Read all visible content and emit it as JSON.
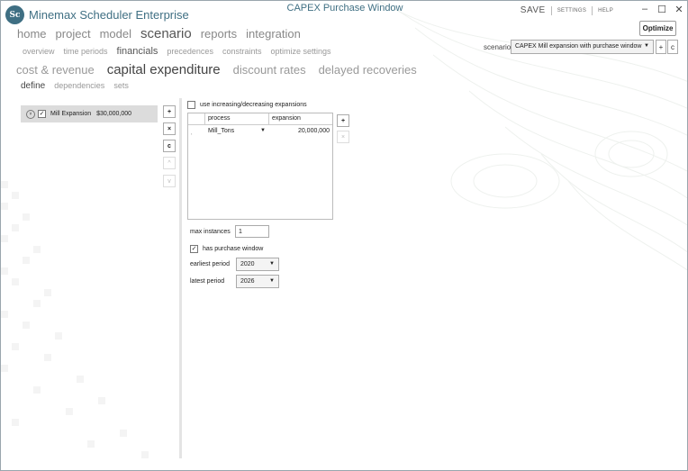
{
  "app": {
    "logo_text": "Sc",
    "name": "Minemax Scheduler Enterprise",
    "window_title": "CAPEX Purchase Window"
  },
  "title_links": {
    "save": "SAVE",
    "settings": "SETTINGS",
    "help": "HELP"
  },
  "window_controls": {
    "minimize": "–",
    "maximize": "☐",
    "close": "✕"
  },
  "optimize_label": "Optimize",
  "nav": {
    "main": [
      "home",
      "project",
      "model",
      "scenario",
      "reports",
      "integration"
    ],
    "main_active": "scenario",
    "scenario_tabs": [
      "overview",
      "time periods",
      "financials",
      "precedences",
      "constraints",
      "optimize settings"
    ],
    "scenario_tabs_active": "financials",
    "financial_tabs": [
      "cost & revenue",
      "capital expenditure",
      "discount rates",
      "delayed recoveries"
    ],
    "financial_tabs_active": "capital expenditure",
    "capex_tabs": [
      "define",
      "dependencies",
      "sets"
    ],
    "capex_tabs_active": "define"
  },
  "scenario": {
    "label": "scenario",
    "selected": "CAPEX Mill expansion with purchase window",
    "add_btn": "+",
    "copy_btn": "c"
  },
  "capex_list": {
    "items": [
      {
        "name": "Mill Expansion",
        "value": "$30,000,000",
        "checked": true
      }
    ],
    "buttons": {
      "add": "+",
      "delete": "×",
      "copy": "c",
      "move_up": "^",
      "move_down": "v"
    }
  },
  "detail": {
    "use_increasing_label": "use increasing/decreasing expansions",
    "use_increasing_checked": false,
    "grid": {
      "columns": [
        "process",
        "expansion"
      ],
      "rows": [
        {
          "process": "Mill_Tons",
          "expansion": "20,000,000"
        }
      ]
    },
    "grid_buttons": {
      "add": "+",
      "remove": "×"
    },
    "max_instances_label": "max instances",
    "max_instances_value": "1",
    "has_purchase_window_label": "has purchase window",
    "has_purchase_window_checked": true,
    "earliest_period_label": "earliest period",
    "earliest_period_value": "2020",
    "latest_period_label": "latest period",
    "latest_period_value": "2026"
  }
}
